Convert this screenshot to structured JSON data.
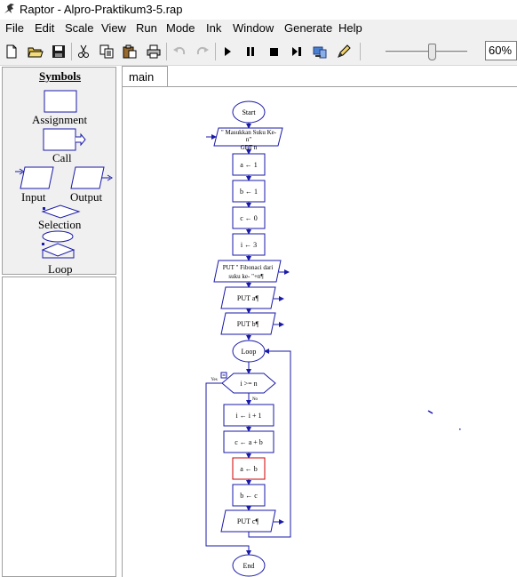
{
  "window": {
    "title": "Raptor - Alpro-Praktikum3-5.rap"
  },
  "menu": [
    "File",
    "Edit",
    "Scale",
    "View",
    "Run",
    "Mode",
    "Ink",
    "Window",
    "Generate",
    "Help"
  ],
  "toolbar": {
    "buttons": [
      "new-file-icon",
      "open-folder-icon",
      "save-icon",
      "cut-icon",
      "copy-icon",
      "paste-icon",
      "print-icon",
      "undo-icon",
      "redo-icon",
      "play-icon",
      "pause-icon",
      "stop-icon",
      "step-icon",
      "test-server-icon",
      "ink-pen-icon"
    ],
    "zoom": 0.6,
    "zoom_label": "60%"
  },
  "symbols": {
    "title": "Symbols",
    "assignment": "Assignment",
    "call": "Call",
    "input": "Input",
    "output": "Output",
    "selection": "Selection",
    "loop": "Loop"
  },
  "tabs": {
    "main": "main"
  },
  "flowchart": {
    "start": "Start",
    "input_prompt_1": "\" Masukkan Suku Ke-",
    "input_prompt_2": "n\"",
    "input_var": "GET n",
    "a_init": "a ← 1",
    "b_init": "b ← 1",
    "c_init": "c ← 0",
    "i_init": "i ← 3",
    "out_title_1": "PUT \" Fibonaci dari",
    "out_title_2": "suku ke- \"+n¶",
    "put_a": "PUT a¶",
    "put_b": "PUT b¶",
    "loop": "Loop",
    "condition": "i >= n",
    "yes": "Yes",
    "no": "No",
    "i_inc": "i ← i + 1",
    "c_sum": "c ← a + b",
    "a_shift": "a ← b",
    "b_shift": "b ← c",
    "put_c": "PUT c¶",
    "end": "End"
  },
  "colors": {
    "flow_stroke": "#1a1aa8",
    "highlight": "#cc0000",
    "panel_bg": "#f0f0f0"
  }
}
